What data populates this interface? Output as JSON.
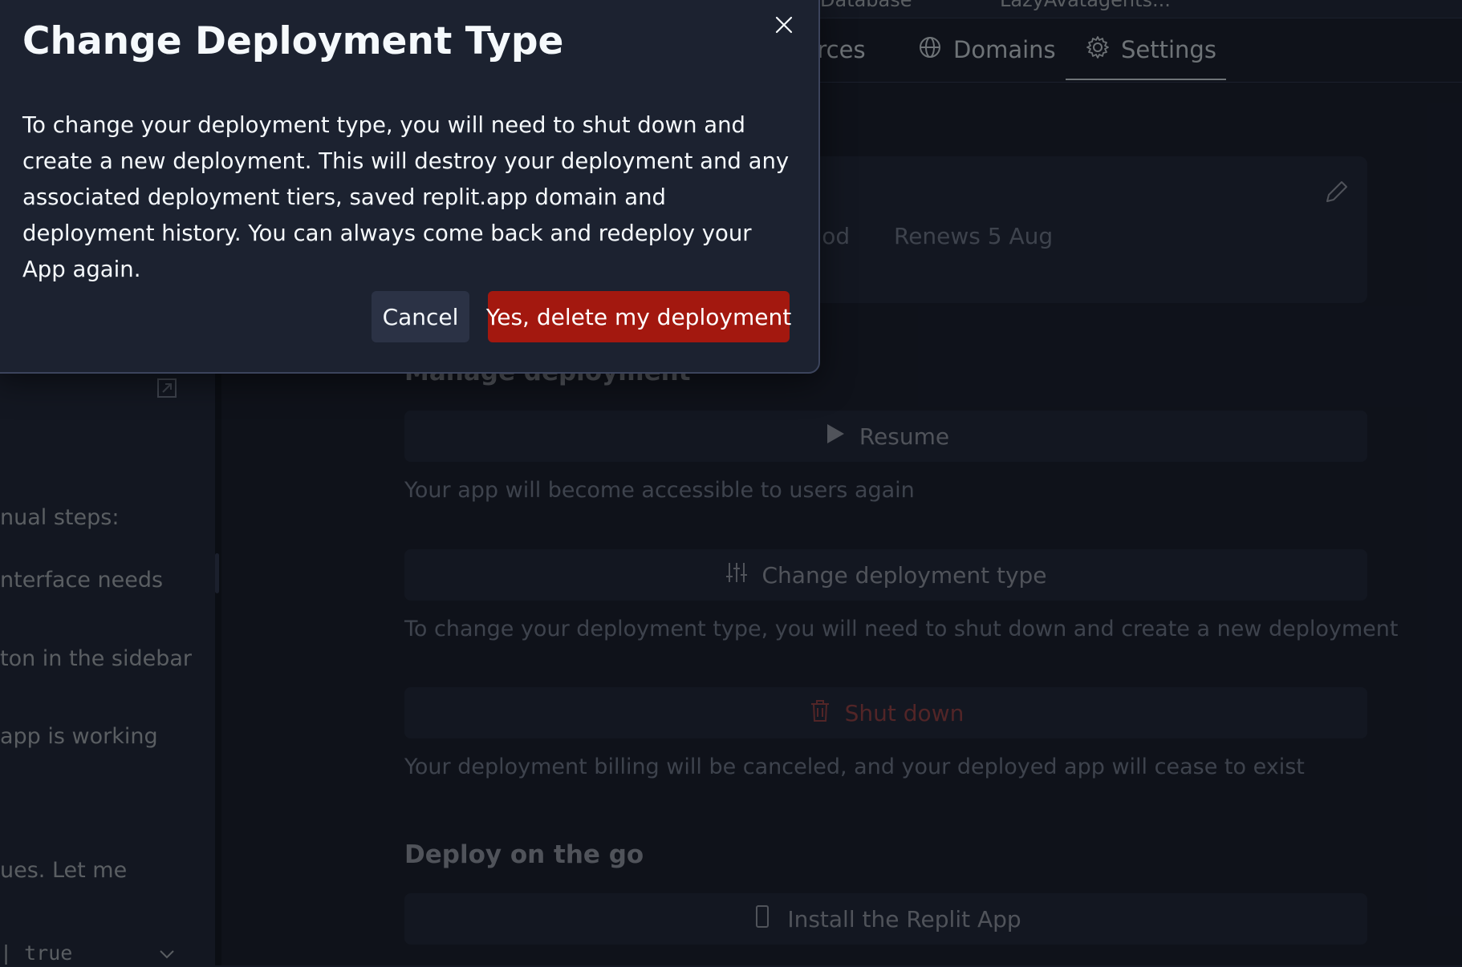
{
  "top_tabs": [
    "Database",
    "LazyAvatagents..."
  ],
  "nav": {
    "tabs": [
      {
        "label": "urces",
        "icon": "resources-icon"
      },
      {
        "label": "Domains",
        "icon": "globe-icon"
      },
      {
        "label": "Settings",
        "icon": "gear-icon",
        "active": true
      }
    ]
  },
  "chat": {
    "lines": [
      "nual steps:",
      "nterface needs",
      "ton in the sidebar",
      "app is working",
      "ues. Let me"
    ],
    "code_line": "| true"
  },
  "card": {
    "period_text": "period",
    "renews_text": "Renews 5 Aug"
  },
  "manage": {
    "title": "Manage deployment",
    "resume_label": "Resume",
    "resume_desc": "Your app will become accessible to users again",
    "change_type_label": "Change deployment type",
    "change_type_desc": "To change your deployment type, you will need to shut down and create a new deployment",
    "shutdown_label": "Shut down",
    "shutdown_desc": "Your deployment billing will be canceled, and your deployed app will cease to exist"
  },
  "deploy_go": {
    "title": "Deploy on the go",
    "install_label": "Install the Replit App"
  },
  "modal": {
    "title": "Change Deployment Type",
    "body": "To change your deployment type, you will need to shut down and create a new deployment. This will destroy your deployment and any associated deployment tiers, saved replit.app domain and deployment history. You can always come back and redeploy your App again.",
    "cancel_label": "Cancel",
    "confirm_label": "Yes, delete my deployment"
  },
  "colors": {
    "background": "#151924",
    "surface": "#1c2230",
    "danger_button": "#a3180f",
    "danger_text": "#8e3b3b"
  }
}
